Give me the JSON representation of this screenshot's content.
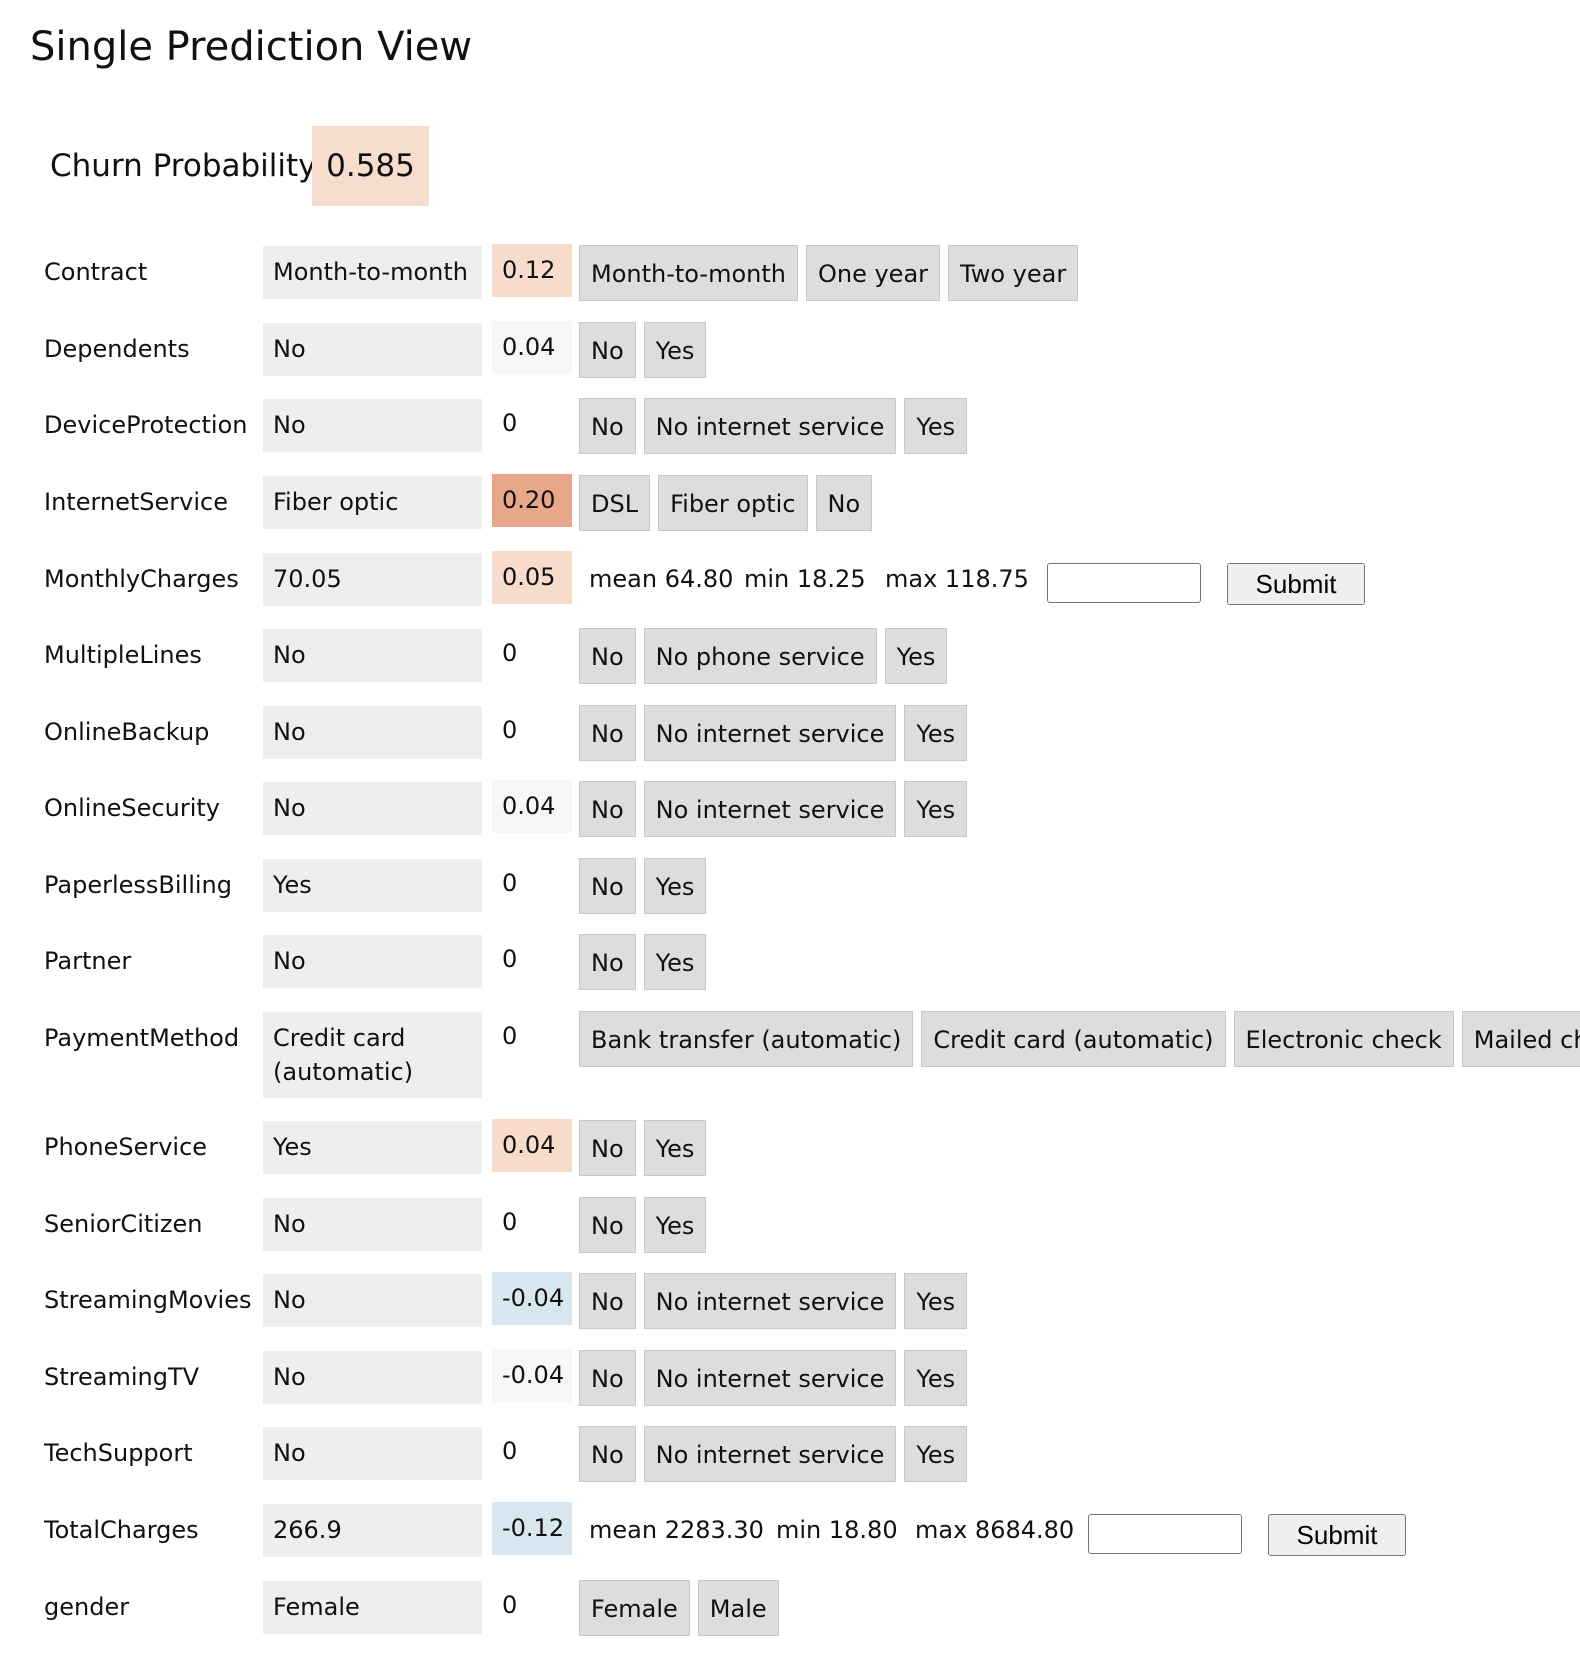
{
  "title": "Single Prediction View",
  "churn": {
    "label": "Churn Probability",
    "value": "0.585"
  },
  "features": [
    {
      "name": "Contract",
      "current": "Month-to-month",
      "contribution": "0.12",
      "contrib_color": "#f7dccb",
      "options": [
        "Month-to-month",
        "One year",
        "Two year"
      ]
    },
    {
      "name": "Dependents",
      "current": "No",
      "contribution": "0.04",
      "contrib_color": "#f7f7f7",
      "options": [
        "No",
        "Yes"
      ]
    },
    {
      "name": "DeviceProtection",
      "current": "No",
      "contribution": "0",
      "contrib_color": "#ffffff",
      "options": [
        "No",
        "No internet service",
        "Yes"
      ]
    },
    {
      "name": "InternetService",
      "current": "Fiber optic",
      "contribution": "0.20",
      "contrib_color": "#e8a78a",
      "options": [
        "DSL",
        "Fiber optic",
        "No"
      ]
    },
    {
      "name": "MonthlyCharges",
      "current": "70.05",
      "contribution": "0.05",
      "contrib_color": "#f7dccb",
      "numeric": true,
      "mean": "mean 64.80",
      "min": "min 18.25",
      "max": "max 118.75",
      "submit": "Submit"
    },
    {
      "name": "MultipleLines",
      "current": "No",
      "contribution": "0",
      "contrib_color": "#ffffff",
      "options": [
        "No",
        "No phone service",
        "Yes"
      ]
    },
    {
      "name": "OnlineBackup",
      "current": "No",
      "contribution": "0",
      "contrib_color": "#ffffff",
      "options": [
        "No",
        "No internet service",
        "Yes"
      ]
    },
    {
      "name": "OnlineSecurity",
      "current": "No",
      "contribution": "0.04",
      "contrib_color": "#f7f7f7",
      "options": [
        "No",
        "No internet service",
        "Yes"
      ]
    },
    {
      "name": "PaperlessBilling",
      "current": "Yes",
      "contribution": "0",
      "contrib_color": "#ffffff",
      "options": [
        "No",
        "Yes"
      ]
    },
    {
      "name": "Partner",
      "current": "No",
      "contribution": "0",
      "contrib_color": "#ffffff",
      "options": [
        "No",
        "Yes"
      ]
    },
    {
      "name": "PaymentMethod",
      "current": "Credit card (automatic)",
      "contribution": "0",
      "contrib_color": "#ffffff",
      "options": [
        "Bank transfer (automatic)",
        "Credit card (automatic)",
        "Electronic check",
        "Mailed check"
      ]
    },
    {
      "name": "PhoneService",
      "current": "Yes",
      "contribution": "0.04",
      "contrib_color": "#f7dccb",
      "options": [
        "No",
        "Yes"
      ]
    },
    {
      "name": "SeniorCitizen",
      "current": "No",
      "contribution": "0",
      "contrib_color": "#ffffff",
      "options": [
        "No",
        "Yes"
      ]
    },
    {
      "name": "StreamingMovies",
      "current": "No",
      "contribution": "-0.04",
      "contrib_color": "#d8e6f0",
      "options": [
        "No",
        "No internet service",
        "Yes"
      ]
    },
    {
      "name": "StreamingTV",
      "current": "No",
      "contribution": "-0.04",
      "contrib_color": "#f7f7f7",
      "options": [
        "No",
        "No internet service",
        "Yes"
      ]
    },
    {
      "name": "TechSupport",
      "current": "No",
      "contribution": "0",
      "contrib_color": "#ffffff",
      "options": [
        "No",
        "No internet service",
        "Yes"
      ]
    },
    {
      "name": "TotalCharges",
      "current": "266.9",
      "contribution": "-0.12",
      "contrib_color": "#d8e6f0",
      "numeric": true,
      "mean": "mean 2283.30",
      "min": "min 18.80",
      "max": "max 8684.80",
      "submit": "Submit"
    },
    {
      "name": "gender",
      "current": "Female",
      "contribution": "0",
      "contrib_color": "#ffffff",
      "options": [
        "Female",
        "Male"
      ]
    }
  ]
}
